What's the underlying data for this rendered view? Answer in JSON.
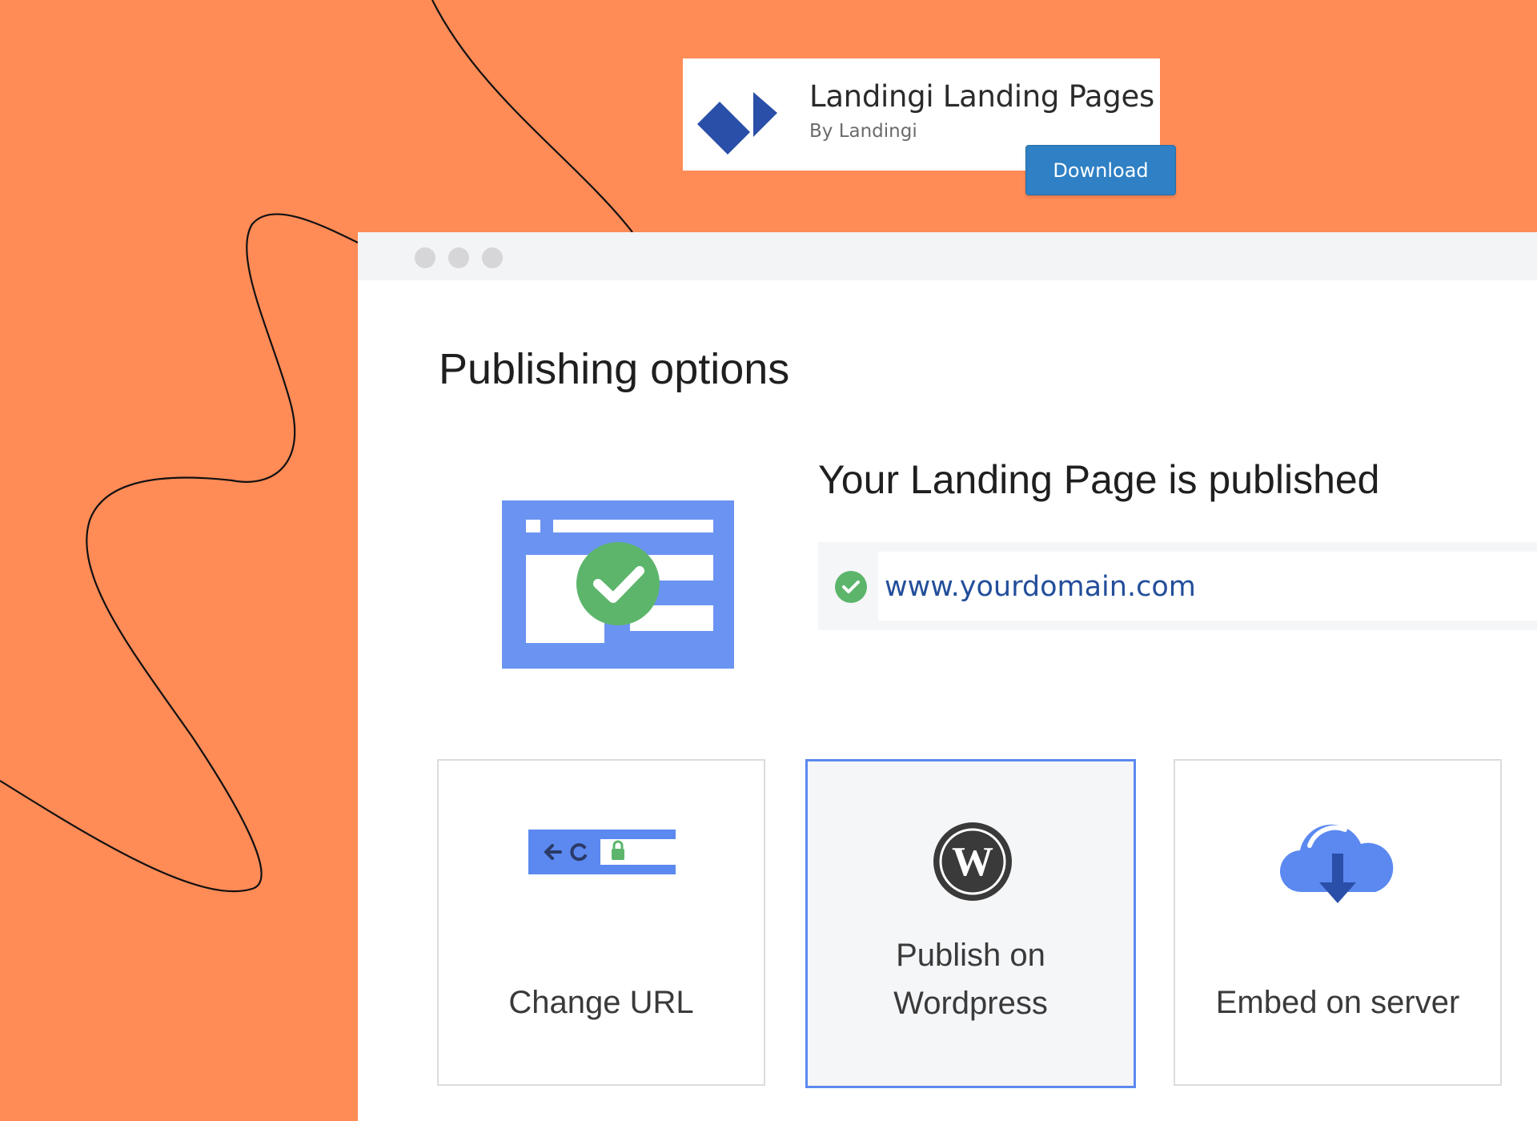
{
  "plugin": {
    "title": "Landingi Landing Pages",
    "author": "By Landingi",
    "download_label": "Download"
  },
  "browser": {
    "page_title": "Publishing options",
    "published_heading": "Your Landing Page is published",
    "url": "www.yourdomain.com"
  },
  "options": [
    {
      "label": "Change URL",
      "icon": "browser-url-bar-icon"
    },
    {
      "label": "Publish on Wordpress",
      "icon": "wordpress-icon",
      "selected": true
    },
    {
      "label": "Embed on server",
      "icon": "cloud-download-icon"
    }
  ],
  "colors": {
    "background": "#FF8B57",
    "accent_blue": "#5B89F0",
    "download_button": "#2F80C4",
    "success_green": "#5CB56B",
    "link_blue": "#234E9A"
  }
}
